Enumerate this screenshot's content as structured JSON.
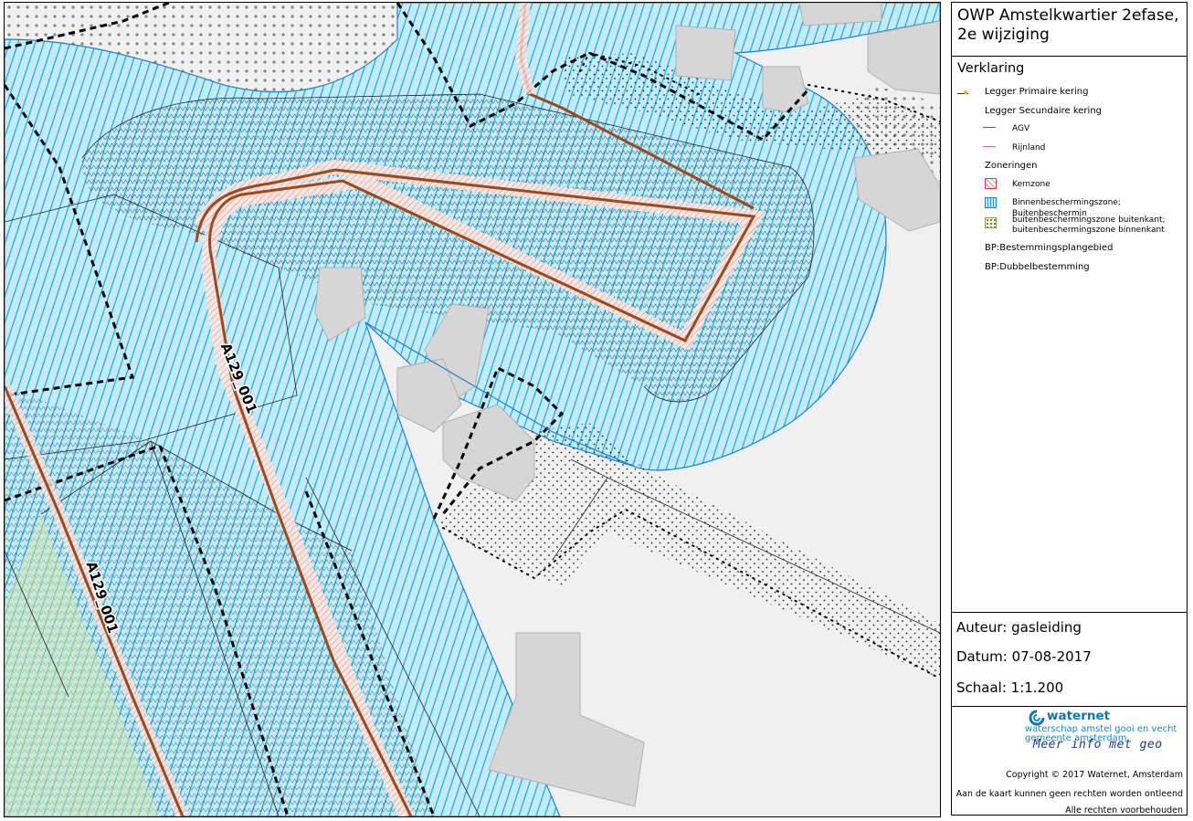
{
  "panel": {
    "title": "OWP Amstelkwartier 2efase, 2e wijziging",
    "legend_title": "Verklaring",
    "legend": {
      "primaire": "Legger Primaire kering",
      "secundaire": "Legger Secundaire kering",
      "agv": "AGV",
      "rijnland": "Rijnland",
      "zoneringen": "Zoneringen",
      "kernzone": "Kernzone",
      "binnen": "Binnenbeschermingszone; Buitenbeschermin",
      "buiten1": "buitenbeschermingszone buitenkant;",
      "buiten2": "buitenbeschermingszone binnenkant",
      "bp_plan": "BP:Bestemmingsplangebied",
      "bp_dubbel": "BP:Dubbelbestemming"
    },
    "auteur": "Auteur: gasleiding",
    "datum": "Datum: 07-08-2017",
    "schaal": "Schaal: 1:1.200",
    "logo": {
      "name": "waternet",
      "line1": "waterschap amstel gooi en vecht",
      "line2": "gemeente amsterdam",
      "tagline": "Meer info met geo"
    },
    "copyright": "Copyright © 2017  Waternet, Amsterdam",
    "disclaimer": "Aan de kaart kunnen geen rechten worden ontleend",
    "rights": "Alle rechten voorbehouden"
  },
  "map": {
    "label_1": "A129_001",
    "label_2": "A129_001"
  },
  "colors": {
    "kering": "#9a4a1e",
    "zone_blue": "#17a6dc",
    "zone_fill": "#bfeaf6",
    "outline_blue": "#1f7fd1",
    "kernzone": "#e83d3d",
    "rijnland": "#cc66cc",
    "building": "#d6d6d6"
  }
}
